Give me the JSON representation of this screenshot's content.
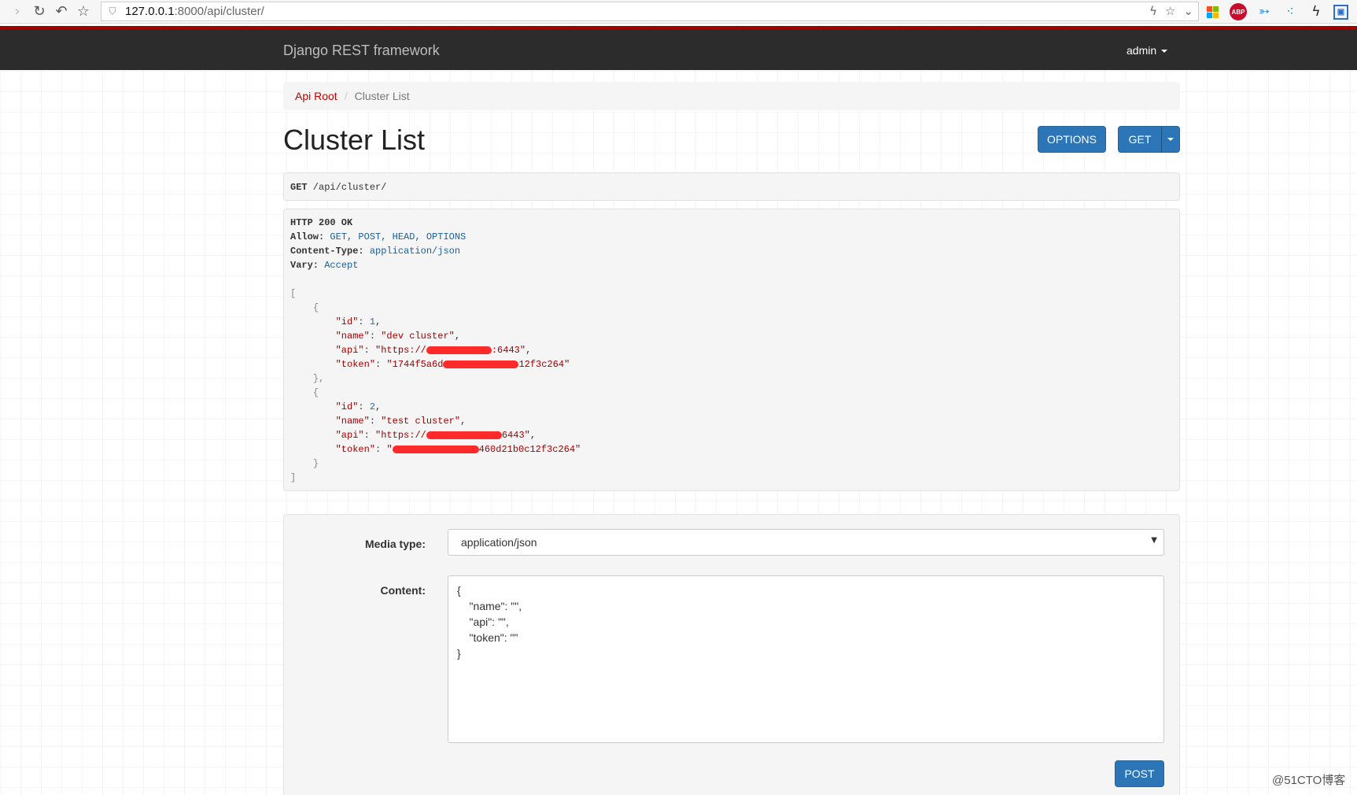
{
  "browser": {
    "url_host": "127.0.0.1",
    "url_rest": ":8000/api/cluster/",
    "abp_label": "ABP"
  },
  "navbar": {
    "brand": "Django REST framework",
    "user": "admin"
  },
  "breadcrumb": {
    "root": "Api Root",
    "current": "Cluster List"
  },
  "page": {
    "title": "Cluster List",
    "options_button": "OPTIONS",
    "get_button": "GET"
  },
  "request": {
    "method": "GET",
    "path": " /api/cluster/"
  },
  "response": {
    "status": "HTTP 200 OK",
    "headers": [
      {
        "name": "Allow:",
        "value": " GET, POST, HEAD, OPTIONS"
      },
      {
        "name": "Content-Type:",
        "value": " application/json"
      },
      {
        "name": "Vary:",
        "value": " Accept"
      }
    ],
    "clusters": [
      {
        "id": "1",
        "name": "\"dev cluster\"",
        "api_prefix": "\"https://",
        "api_suffix": ":6443\"",
        "token_prefix": "\"1744f5a6d",
        "token_suffix": "12f3c264\""
      },
      {
        "id": "2",
        "name": "\"test cluster\"",
        "api_prefix": "\"https://",
        "api_suffix": "6443\"",
        "token_prefix": "\"",
        "token_suffix": "460d21b0c12f3c264\""
      }
    ]
  },
  "form": {
    "media_type_label": "Media type:",
    "media_type_value": "application/json",
    "content_label": "Content:",
    "content_value": "{\n    \"name\": \"\",\n    \"api\": \"\",\n    \"token\": \"\"\n}",
    "post_button": "POST"
  },
  "watermark": "@51CTO博客",
  "colors": {
    "navbar_bg": "#2c2c2c",
    "navbar_accent": "#a30000",
    "button_blue": "#2c76b8",
    "link_red": "#c20000",
    "redaction": "#ff2a2a"
  }
}
